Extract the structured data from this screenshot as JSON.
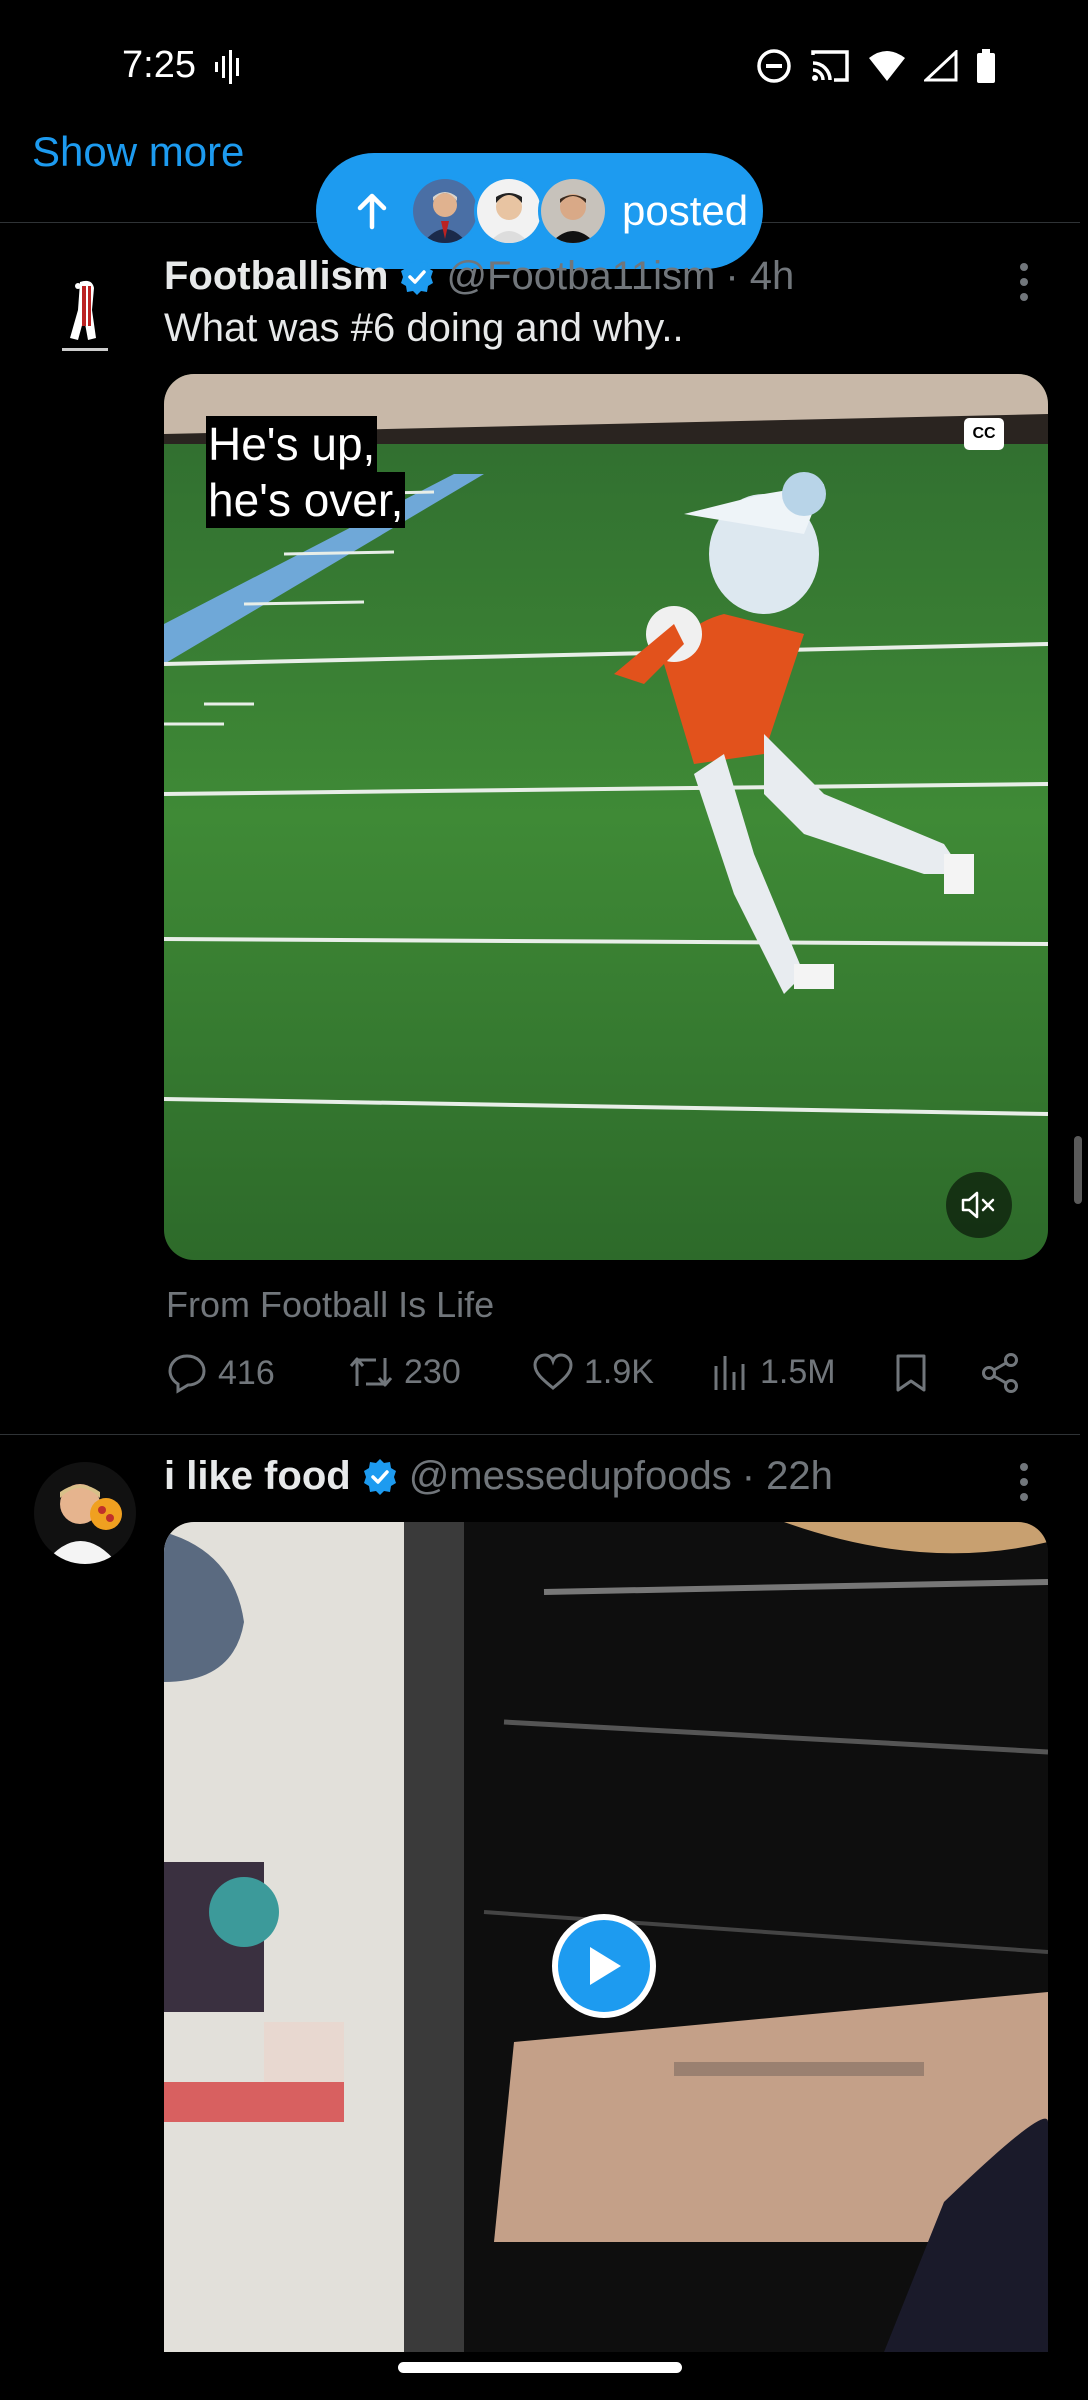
{
  "status_bar": {
    "time": "7:25",
    "icons": [
      "audio-wave-icon",
      "do-not-disturb-icon",
      "cast-icon",
      "wifi-icon",
      "signal-icon",
      "battery-icon"
    ]
  },
  "show_more": "Show more",
  "new_posts_pill": {
    "label": "posted",
    "icon": "arrow-up-icon"
  },
  "tweets": [
    {
      "name": "Footballism",
      "handle": "@Footba11ism",
      "time": "· 4h",
      "text": "What was #6 doing and why..",
      "caption_line1": "He's up,",
      "caption_line2": "he's over,",
      "cc": "CC",
      "source": "From Football Is Life",
      "replies": "416",
      "reposts": "230",
      "likes": "1.9K",
      "views": "1.5M"
    },
    {
      "name": "i like food",
      "handle": "@messedupfoods",
      "time": "· 22h"
    }
  ],
  "colors": {
    "accent": "#1d9bf0",
    "background": "#000000",
    "secondary_text": "#71767b"
  }
}
